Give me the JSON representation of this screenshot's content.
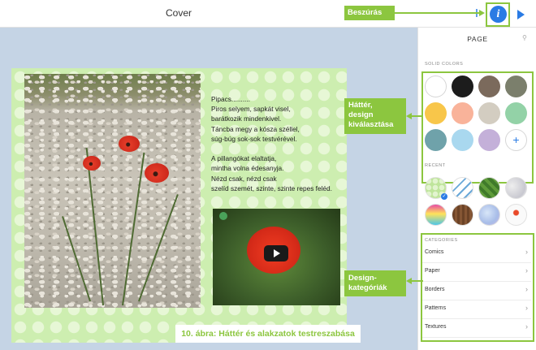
{
  "topbar": {
    "title": "Cover",
    "add_icon": "plus-icon",
    "info_icon": "info-icon",
    "info_glyph": "i",
    "play_icon": "play-icon"
  },
  "page_content": {
    "poem_lines": [
      "Pipacs..........",
      "Piros selyem, sapkát visel,",
      "barátkozik mindenkivel.",
      "Táncba megy a kósza széllel,",
      "súg-búg sok-sok testvérével.",
      "",
      "A pillangókat elaltatja,",
      "mintha volna édesanyja.",
      "Nézd csak, nézd csak",
      "szelíd szemét, szinte, szinte repes feléd."
    ],
    "video_play_icon": "play-icon"
  },
  "panel": {
    "title": "PAGE",
    "pin_icon": "pin-icon",
    "solid_colors_label": "SOLID COLORS",
    "solid_colors": [
      "#ffffff",
      "#1c1c1c",
      "#7b6a5c",
      "#7b7f6c",
      "#f8c64a",
      "#f9b39a",
      "#d3cdc1",
      "#93d2a7",
      "#6fa2aa",
      "#a9d8ef",
      "#c4b0d9"
    ],
    "add_color_label": "+",
    "recent_label": "RECENT",
    "recent_icons": [
      "polka-dot-green-pattern-icon",
      "dna-pattern-icon",
      "green-geometric-pattern-icon",
      "marble-pattern-icon",
      "rainbow-gradient-icon",
      "wood-texture-icon",
      "blue-watercolor-icon",
      "floral-pattern-icon"
    ],
    "selected_check": "✓",
    "categories_label": "CATEGORIES",
    "categories": [
      "Comics",
      "Paper",
      "Borders",
      "Patterns",
      "Textures"
    ],
    "chevron": "›"
  },
  "callouts": {
    "insert": "Beszúrás",
    "background": [
      "Háttér,",
      "design",
      "kiválasztása"
    ],
    "categories": [
      "Design-",
      "kategóriák"
    ]
  },
  "caption": "10. ábra: Háttér és alakzatok testreszabása",
  "colors": {
    "accent_green": "#8cc63f",
    "accent_blue": "#2a7be4",
    "canvas_bg": "#c5d4e5"
  }
}
